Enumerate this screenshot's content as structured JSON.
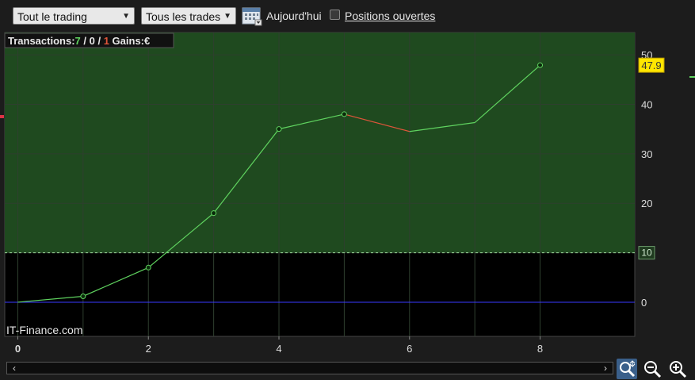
{
  "toolbar": {
    "filter_select": "Tout le trading",
    "trades_select": "Tous les trades",
    "today_label": "Aujourd'hui",
    "open_positions_label": "Positions ouvertes",
    "open_positions_checked": false
  },
  "summary": {
    "transactions_label": "Transactions:",
    "wins": "7",
    "sep1": " / ",
    "neutral": "0",
    "sep2": " / ",
    "losses": "1",
    "gains_label": "Gains:",
    "currency": "€"
  },
  "watermark": "IT-Finance.com",
  "colors": {
    "up": "#5fd35f",
    "down": "#e0553a",
    "zero_line": "#3a3aff",
    "positive_zone": "#1f4a1f",
    "last_value_bg": "#ffe600",
    "threshold_bg": "#1f3a1f"
  },
  "chart_data": {
    "type": "line",
    "x": [
      0,
      1,
      2,
      3,
      4,
      5,
      6,
      7,
      8
    ],
    "y": [
      0,
      1.2,
      7,
      18,
      35,
      38,
      34.5,
      36.3,
      47.9
    ],
    "markers_at": [
      1,
      2,
      3,
      4,
      5,
      8
    ],
    "xlim": [
      -0.2,
      9.45
    ],
    "ylim": [
      -6.9,
      54.5
    ],
    "x_ticks": [
      0,
      2,
      4,
      6,
      8
    ],
    "y_ticks": [
      0,
      10,
      20,
      30,
      40,
      50
    ],
    "threshold": 10,
    "threshold_label": "10",
    "last_value_label": "47.9",
    "grid": true
  }
}
